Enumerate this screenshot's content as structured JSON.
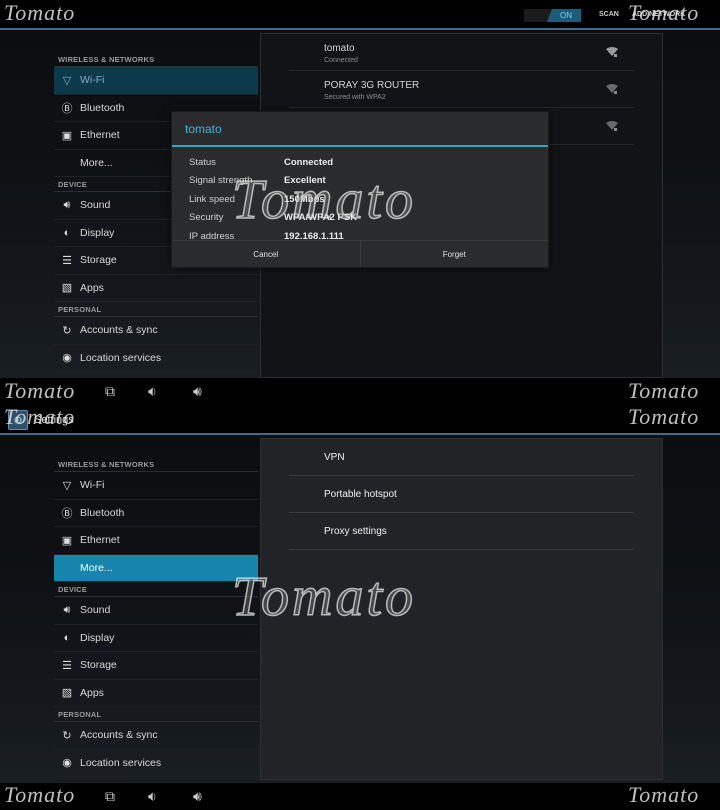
{
  "app": {
    "title": "Settings",
    "icon": "settings-app-icon"
  },
  "colors": {
    "accent": "#33b5e5",
    "selected_blue": "#1685ad",
    "selected_dark": "#0d3a4b",
    "divider": "#3b6f8c"
  },
  "top_screen": {
    "actionbar": {
      "wifi_toggle": {
        "off_label": "",
        "on_label": "ON",
        "state": "on"
      },
      "scan_label": "SCAN",
      "add_network_label": "ADD NETWORK"
    },
    "sidebar": {
      "sections": [
        {
          "header": "WIRELESS & NETWORKS",
          "items": [
            {
              "label": "Wi-Fi",
              "icon": "wifi-icon",
              "selected": true
            },
            {
              "label": "Bluetooth",
              "icon": "bluetooth-icon"
            },
            {
              "label": "Ethernet",
              "icon": "ethernet-icon"
            },
            {
              "label": "More...",
              "icon": ""
            }
          ]
        },
        {
          "header": "DEVICE",
          "items": [
            {
              "label": "Sound",
              "icon": "sound-icon"
            },
            {
              "label": "Display",
              "icon": "display-icon"
            },
            {
              "label": "Storage",
              "icon": "storage-icon"
            },
            {
              "label": "Apps",
              "icon": "apps-icon"
            }
          ]
        },
        {
          "header": "PERSONAL",
          "items": [
            {
              "label": "Accounts & sync",
              "icon": "sync-icon"
            },
            {
              "label": "Location services",
              "icon": "location-icon"
            }
          ]
        }
      ]
    },
    "networks": [
      {
        "name": "tomato",
        "status": "Connected",
        "icon": "wifi-locked-icon"
      },
      {
        "name": "PORAY 3G ROUTER",
        "status": "Secured with WPA2",
        "icon": "wifi-locked-icon"
      },
      {
        "name": "",
        "status": "",
        "icon": "wifi-locked-icon"
      }
    ],
    "dialog": {
      "title": "tomato",
      "rows": [
        {
          "key": "Status",
          "value": "Connected"
        },
        {
          "key": "Signal strength",
          "value": "Excellent"
        },
        {
          "key": "Link speed",
          "value": "150Mbps"
        },
        {
          "key": "Security",
          "value": "WPA/WPA2 PSK"
        },
        {
          "key": "IP address",
          "value": "192.168.1.111"
        }
      ],
      "cancel_label": "Cancel",
      "forget_label": "Forget"
    }
  },
  "bottom_screen": {
    "sidebar_selected": "More...",
    "more_items": [
      {
        "label": "VPN"
      },
      {
        "label": "Portable hotspot"
      },
      {
        "label": "Proxy settings"
      }
    ]
  },
  "navbar": {
    "buttons": [
      "recent-apps-icon",
      "volume-down-icon",
      "volume-up-icon"
    ]
  },
  "watermark": {
    "text": "Tomato"
  }
}
